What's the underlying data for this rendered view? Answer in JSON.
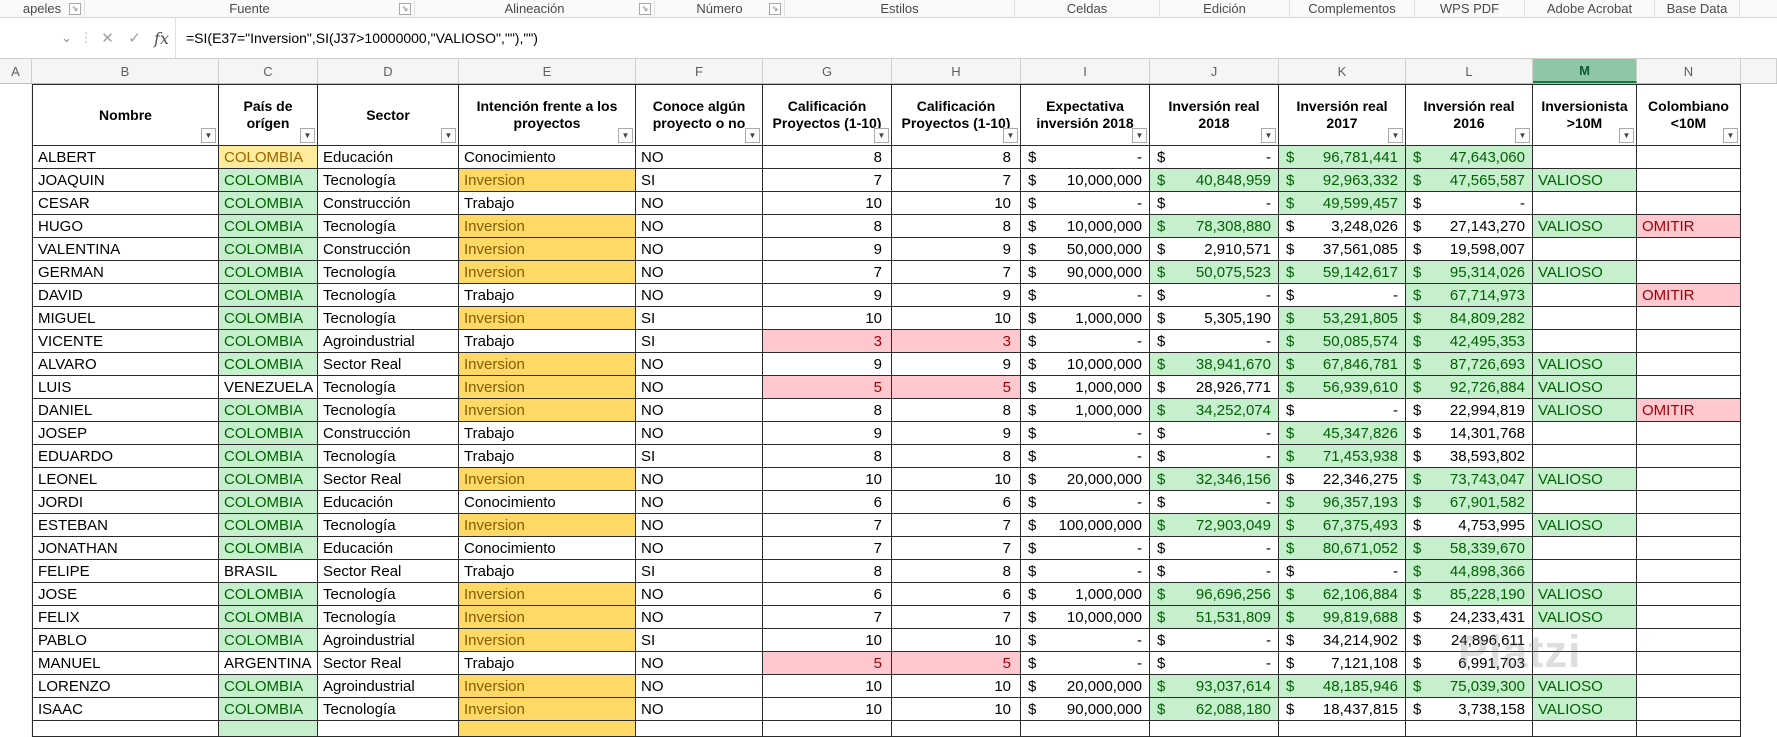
{
  "ribbon": {
    "groups": [
      {
        "label": "apeles",
        "launcher": true
      },
      {
        "label": "Fuente",
        "launcher": true
      },
      {
        "label": "Alineación",
        "launcher": true
      },
      {
        "label": "Número",
        "launcher": true
      },
      {
        "label": "Estilos",
        "launcher": false
      },
      {
        "label": "Celdas",
        "launcher": false
      },
      {
        "label": "Edición",
        "launcher": false
      },
      {
        "label": "Complementos",
        "launcher": false
      },
      {
        "label": "WPS PDF",
        "launcher": false
      },
      {
        "label": "Adobe Acrobat",
        "launcher": false
      },
      {
        "label": "Base Data",
        "launcher": false
      }
    ]
  },
  "formula_bar": {
    "name_box_chevron": "⌄",
    "dots": "⋮",
    "cancel": "✕",
    "enter": "✓",
    "fx": "fx",
    "formula": "=SI(E37=\"Inversion\",SI(J37>10000000,\"VALIOSO\",\"\"),\"\")"
  },
  "sheet": {
    "column_letters": [
      "A",
      "B",
      "C",
      "D",
      "E",
      "F",
      "G",
      "H",
      "I",
      "J",
      "K",
      "L",
      "M",
      "N"
    ],
    "selected_column": "M",
    "active_cell": {
      "column": "M",
      "row_index": 0
    },
    "filter_icon": "▼",
    "currency_symbol": "$",
    "headers": [
      "Nombre",
      "País de orígen",
      "Sector",
      "Intención frente a los proyectos",
      "Conoce algún proyecto o no",
      "Calificación Proyectos (1-10)",
      "Calificación Proyectos (1-10)",
      "Expectativa inversión 2018",
      "Inversión real 2018",
      "Inversión real 2017",
      "Inversión real 2016",
      "Inversionista >10M",
      "Colombiano <10M"
    ],
    "rows": [
      {
        "name": "ALBERT",
        "country": "COLOMBIA",
        "country_style": "neutral",
        "sector": "Educación",
        "intent": "Conocimiento",
        "intent_style": "plain",
        "knows": "NO",
        "score_g": "8",
        "score_h": "8",
        "score_style": "plain",
        "expect_2018": "-",
        "real_2018": "-",
        "real_2018_good": false,
        "real_2017": "96,781,441",
        "real_2017_good": true,
        "real_2016": "47,643,060",
        "real_2016_good": true,
        "investor": "",
        "omit": ""
      },
      {
        "name": "JOAQUIN",
        "country": "COLOMBIA",
        "country_style": "good",
        "sector": "Tecnología",
        "intent": "Inversion",
        "intent_style": "neutral",
        "knows": "SI",
        "score_g": "7",
        "score_h": "7",
        "score_style": "plain",
        "expect_2018": "10,000,000",
        "real_2018": "40,848,959",
        "real_2018_good": true,
        "real_2017": "92,963,332",
        "real_2017_good": true,
        "real_2016": "47,565,587",
        "real_2016_good": true,
        "investor": "VALIOSO",
        "omit": ""
      },
      {
        "name": "CESAR",
        "country": "COLOMBIA",
        "country_style": "good",
        "sector": "Construcción",
        "intent": "Trabajo",
        "intent_style": "plain",
        "knows": "NO",
        "score_g": "10",
        "score_h": "10",
        "score_style": "plain",
        "expect_2018": "-",
        "real_2018": "-",
        "real_2018_good": false,
        "real_2017": "49,599,457",
        "real_2017_good": true,
        "real_2016": "-",
        "real_2016_good": false,
        "investor": "",
        "omit": ""
      },
      {
        "name": "HUGO",
        "country": "COLOMBIA",
        "country_style": "good",
        "sector": "Tecnología",
        "intent": "Inversion",
        "intent_style": "neutral",
        "knows": "NO",
        "score_g": "8",
        "score_h": "8",
        "score_style": "plain",
        "expect_2018": "10,000,000",
        "real_2018": "78,308,880",
        "real_2018_good": true,
        "real_2017": "3,248,026",
        "real_2017_good": false,
        "real_2016": "27,143,270",
        "real_2016_good": false,
        "investor": "VALIOSO",
        "omit": "OMITIR"
      },
      {
        "name": "VALENTINA",
        "country": "COLOMBIA",
        "country_style": "good",
        "sector": "Construcción",
        "intent": "Inversion",
        "intent_style": "neutral",
        "knows": "NO",
        "score_g": "9",
        "score_h": "9",
        "score_style": "plain",
        "expect_2018": "50,000,000",
        "real_2018": "2,910,571",
        "real_2018_good": false,
        "real_2017": "37,561,085",
        "real_2017_good": false,
        "real_2016": "19,598,007",
        "real_2016_good": false,
        "investor": "",
        "omit": ""
      },
      {
        "name": "GERMAN",
        "country": "COLOMBIA",
        "country_style": "good",
        "sector": "Tecnología",
        "intent": "Inversion",
        "intent_style": "neutral",
        "knows": "NO",
        "score_g": "7",
        "score_h": "7",
        "score_style": "plain",
        "expect_2018": "90,000,000",
        "real_2018": "50,075,523",
        "real_2018_good": true,
        "real_2017": "59,142,617",
        "real_2017_good": true,
        "real_2016": "95,314,026",
        "real_2016_good": true,
        "investor": "VALIOSO",
        "omit": ""
      },
      {
        "name": "DAVID",
        "country": "COLOMBIA",
        "country_style": "good",
        "sector": "Tecnología",
        "intent": "Trabajo",
        "intent_style": "plain",
        "knows": "NO",
        "score_g": "9",
        "score_h": "9",
        "score_style": "plain",
        "expect_2018": "-",
        "real_2018": "-",
        "real_2018_good": false,
        "real_2017": "-",
        "real_2017_good": false,
        "real_2016": "67,714,973",
        "real_2016_good": true,
        "investor": "",
        "omit": "OMITIR"
      },
      {
        "name": "MIGUEL",
        "country": "COLOMBIA",
        "country_style": "good",
        "sector": "Tecnología",
        "intent": "Inversion",
        "intent_style": "neutral",
        "knows": "SI",
        "score_g": "10",
        "score_h": "10",
        "score_style": "plain",
        "expect_2018": "1,000,000",
        "real_2018": "5,305,190",
        "real_2018_good": false,
        "real_2017": "53,291,805",
        "real_2017_good": true,
        "real_2016": "84,809,282",
        "real_2016_good": true,
        "investor": "",
        "omit": ""
      },
      {
        "name": "VICENTE",
        "country": "COLOMBIA",
        "country_style": "good",
        "sector": "Agroindustrial",
        "intent": "Trabajo",
        "intent_style": "plain",
        "knows": "SI",
        "score_g": "3",
        "score_h": "3",
        "score_style": "bad",
        "expect_2018": "-",
        "real_2018": "-",
        "real_2018_good": false,
        "real_2017": "50,085,574",
        "real_2017_good": true,
        "real_2016": "42,495,353",
        "real_2016_good": true,
        "investor": "",
        "omit": ""
      },
      {
        "name": "ALVARO",
        "country": "COLOMBIA",
        "country_style": "good",
        "sector": "Sector Real",
        "intent": "Inversion",
        "intent_style": "neutral",
        "knows": "NO",
        "score_g": "9",
        "score_h": "9",
        "score_style": "plain",
        "expect_2018": "10,000,000",
        "real_2018": "38,941,670",
        "real_2018_good": true,
        "real_2017": "67,846,781",
        "real_2017_good": true,
        "real_2016": "87,726,693",
        "real_2016_good": true,
        "investor": "VALIOSO",
        "omit": ""
      },
      {
        "name": "LUIS",
        "country": "VENEZUELA",
        "country_style": "plain",
        "sector": "Tecnología",
        "intent": "Inversion",
        "intent_style": "neutral",
        "knows": "NO",
        "score_g": "5",
        "score_h": "5",
        "score_style": "bad",
        "expect_2018": "1,000,000",
        "real_2018": "28,926,771",
        "real_2018_good": false,
        "real_2017": "56,939,610",
        "real_2017_good": true,
        "real_2016": "92,726,884",
        "real_2016_good": true,
        "investor": "VALIOSO",
        "omit": ""
      },
      {
        "name": "DANIEL",
        "country": "COLOMBIA",
        "country_style": "good",
        "sector": "Tecnología",
        "intent": "Inversion",
        "intent_style": "neutral",
        "knows": "NO",
        "score_g": "8",
        "score_h": "8",
        "score_style": "plain",
        "expect_2018": "1,000,000",
        "real_2018": "34,252,074",
        "real_2018_good": true,
        "real_2017": "-",
        "real_2017_good": false,
        "real_2016": "22,994,819",
        "real_2016_good": false,
        "investor": "VALIOSO",
        "omit": "OMITIR"
      },
      {
        "name": "JOSEP",
        "country": "COLOMBIA",
        "country_style": "good",
        "sector": "Construcción",
        "intent": "Trabajo",
        "intent_style": "plain",
        "knows": "NO",
        "score_g": "9",
        "score_h": "9",
        "score_style": "plain",
        "expect_2018": "-",
        "real_2018": "-",
        "real_2018_good": false,
        "real_2017": "45,347,826",
        "real_2017_good": true,
        "real_2016": "14,301,768",
        "real_2016_good": false,
        "investor": "",
        "omit": ""
      },
      {
        "name": "EDUARDO",
        "country": "COLOMBIA",
        "country_style": "good",
        "sector": "Tecnología",
        "intent": "Trabajo",
        "intent_style": "plain",
        "knows": "SI",
        "score_g": "8",
        "score_h": "8",
        "score_style": "plain",
        "expect_2018": "-",
        "real_2018": "-",
        "real_2018_good": false,
        "real_2017": "71,453,938",
        "real_2017_good": true,
        "real_2016": "38,593,802",
        "real_2016_good": false,
        "investor": "",
        "omit": ""
      },
      {
        "name": "LEONEL",
        "country": "COLOMBIA",
        "country_style": "good",
        "sector": "Sector Real",
        "intent": "Inversion",
        "intent_style": "neutral",
        "knows": "NO",
        "score_g": "10",
        "score_h": "10",
        "score_style": "plain",
        "expect_2018": "20,000,000",
        "real_2018": "32,346,156",
        "real_2018_good": true,
        "real_2017": "22,346,275",
        "real_2017_good": false,
        "real_2016": "73,743,047",
        "real_2016_good": true,
        "investor": "VALIOSO",
        "omit": ""
      },
      {
        "name": "JORDI",
        "country": "COLOMBIA",
        "country_style": "good",
        "sector": "Educación",
        "intent": "Conocimiento",
        "intent_style": "plain",
        "knows": "NO",
        "score_g": "6",
        "score_h": "6",
        "score_style": "plain",
        "expect_2018": "-",
        "real_2018": "-",
        "real_2018_good": false,
        "real_2017": "96,357,193",
        "real_2017_good": true,
        "real_2016": "67,901,582",
        "real_2016_good": true,
        "investor": "",
        "omit": ""
      },
      {
        "name": "ESTEBAN",
        "country": "COLOMBIA",
        "country_style": "good",
        "sector": "Tecnología",
        "intent": "Inversion",
        "intent_style": "neutral",
        "knows": "NO",
        "score_g": "7",
        "score_h": "7",
        "score_style": "plain",
        "expect_2018": "100,000,000",
        "real_2018": "72,903,049",
        "real_2018_good": true,
        "real_2017": "67,375,493",
        "real_2017_good": true,
        "real_2016": "4,753,995",
        "real_2016_good": false,
        "investor": "VALIOSO",
        "omit": ""
      },
      {
        "name": "JONATHAN",
        "country": "COLOMBIA",
        "country_style": "good",
        "sector": "Educación",
        "intent": "Conocimiento",
        "intent_style": "plain",
        "knows": "NO",
        "score_g": "7",
        "score_h": "7",
        "score_style": "plain",
        "expect_2018": "-",
        "real_2018": "-",
        "real_2018_good": false,
        "real_2017": "80,671,052",
        "real_2017_good": true,
        "real_2016": "58,339,670",
        "real_2016_good": true,
        "investor": "",
        "omit": ""
      },
      {
        "name": "FELIPE",
        "country": "BRASIL",
        "country_style": "plain",
        "sector": "Sector Real",
        "intent": "Trabajo",
        "intent_style": "plain",
        "knows": "SI",
        "score_g": "8",
        "score_h": "8",
        "score_style": "plain",
        "expect_2018": "-",
        "real_2018": "-",
        "real_2018_good": false,
        "real_2017": "-",
        "real_2017_good": false,
        "real_2016": "44,898,366",
        "real_2016_good": true,
        "investor": "",
        "omit": ""
      },
      {
        "name": "JOSE",
        "country": "COLOMBIA",
        "country_style": "good",
        "sector": "Tecnología",
        "intent": "Inversion",
        "intent_style": "neutral",
        "knows": "NO",
        "score_g": "6",
        "score_h": "6",
        "score_style": "plain",
        "expect_2018": "1,000,000",
        "real_2018": "96,696,256",
        "real_2018_good": true,
        "real_2017": "62,106,884",
        "real_2017_good": true,
        "real_2016": "85,228,190",
        "real_2016_good": true,
        "investor": "VALIOSO",
        "omit": ""
      },
      {
        "name": "FELIX",
        "country": "COLOMBIA",
        "country_style": "good",
        "sector": "Tecnología",
        "intent": "Inversion",
        "intent_style": "neutral",
        "knows": "NO",
        "score_g": "7",
        "score_h": "7",
        "score_style": "plain",
        "expect_2018": "10,000,000",
        "real_2018": "51,531,809",
        "real_2018_good": true,
        "real_2017": "99,819,688",
        "real_2017_good": true,
        "real_2016": "24,233,431",
        "real_2016_good": false,
        "investor": "VALIOSO",
        "omit": ""
      },
      {
        "name": "PABLO",
        "country": "COLOMBIA",
        "country_style": "good",
        "sector": "Agroindustrial",
        "intent": "Inversion",
        "intent_style": "neutral",
        "knows": "SI",
        "score_g": "10",
        "score_h": "10",
        "score_style": "plain",
        "expect_2018": "-",
        "real_2018": "-",
        "real_2018_good": false,
        "real_2017": "34,214,902",
        "real_2017_good": false,
        "real_2016": "24,896,611",
        "real_2016_good": false,
        "investor": "",
        "omit": ""
      },
      {
        "name": "MANUEL",
        "country": "ARGENTINA",
        "country_style": "plain",
        "sector": "Sector Real",
        "intent": "Trabajo",
        "intent_style": "plain",
        "knows": "NO",
        "score_g": "5",
        "score_h": "5",
        "score_style": "bad",
        "expect_2018": "-",
        "real_2018": "-",
        "real_2018_good": false,
        "real_2017": "7,121,108",
        "real_2017_good": false,
        "real_2016": "6,991,703",
        "real_2016_good": false,
        "investor": "",
        "omit": ""
      },
      {
        "name": "LORENZO",
        "country": "COLOMBIA",
        "country_style": "good",
        "sector": "Agroindustrial",
        "intent": "Inversion",
        "intent_style": "neutral",
        "knows": "NO",
        "score_g": "10",
        "score_h": "10",
        "score_style": "plain",
        "expect_2018": "20,000,000",
        "real_2018": "93,037,614",
        "real_2018_good": true,
        "real_2017": "48,185,946",
        "real_2017_good": true,
        "real_2016": "75,039,300",
        "real_2016_good": true,
        "investor": "VALIOSO",
        "omit": ""
      },
      {
        "name": "ISAAC",
        "country": "COLOMBIA",
        "country_style": "good",
        "sector": "Tecnología",
        "intent": "Inversion",
        "intent_style": "neutral",
        "knows": "NO",
        "score_g": "10",
        "score_h": "10",
        "score_style": "plain",
        "expect_2018": "90,000,000",
        "real_2018": "62,088,180",
        "real_2018_good": true,
        "real_2017": "18,437,815",
        "real_2017_good": false,
        "real_2016": "3,738,158",
        "real_2016_good": false,
        "investor": "VALIOSO",
        "omit": ""
      }
    ],
    "partial_row": {
      "country_style": "good",
      "intent_style": "neutral"
    }
  },
  "watermark": "Platzi"
}
